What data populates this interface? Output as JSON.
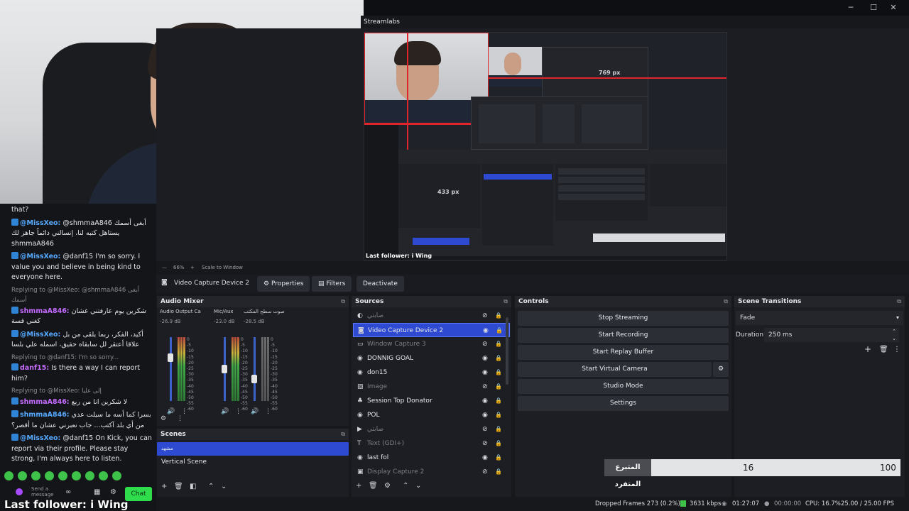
{
  "window": {
    "app_label": "Streamlabs",
    "min_icon": "minimize-icon",
    "max_icon": "maximize-icon",
    "close_icon": "close-icon"
  },
  "chat": {
    "top_text": "that?",
    "messages": [
      {
        "user": "@MissXeo:",
        "text": "@shmmaA846 أبغى أسمك يستاهل كتبه لنا، إنسالني دائماً جاهز لك shmmaA846",
        "kind": "main"
      },
      {
        "user": "@MissXeo:",
        "text": "@danf15 I'm so sorry. I value you and believe in being kind to everyone here.",
        "kind": "main"
      },
      {
        "reply": "Replying to @MissXeo: @shmmaA846 أبغى أسمك",
        "user": "shmmaA846:",
        "text": "شكرين يوم عارفتني غشان كغني قسة",
        "kind": "pink"
      },
      {
        "user": "@MissXeo:",
        "text": "أكيد، الفكر، ربما يلقى من بل علاقا أعتقر لل سابقاه حقيق، اسمله علي بلسا",
        "kind": "main"
      },
      {
        "reply": "Replying to @danf15: I'm so sorry...",
        "user": "danf15:",
        "text": "Is there a way I can report him?",
        "kind": "pink"
      },
      {
        "reply": "Replying to @MissXeo: إلى عليا",
        "user": "shmmaA846:",
        "text": "لا شكرين انا من ربع",
        "kind": "pink"
      },
      {
        "user": "shmmaA846:",
        "text": "بسرا كما أسه ما سيلت عدي من أي بلد آكتب... جاب نعبرني عشان ما أقصر؟",
        "kind": "main"
      },
      {
        "user": "@MissXeo:",
        "text": "@danf15 On Kick, you can report via their profile. Please stay strong, I'm always here to listen.",
        "kind": "main"
      }
    ],
    "send_label": "Send a message",
    "chat_button": "Chat",
    "last_follower": "Last follower: i Wing"
  },
  "preview": {
    "nested_label_px": "769 px",
    "nested_label_small": "433 px",
    "nested_follower": "Last follower: i Wing",
    "zoom": "66%",
    "scale_mode": "Scale to Window"
  },
  "source_toolbar": {
    "source_name": "Video Capture Device 2",
    "properties": "Properties",
    "filters": "Filters",
    "deactivate": "Deactivate"
  },
  "audio_mixer": {
    "title": "Audio Mixer",
    "channels": [
      {
        "name": "Audio Output Capt",
        "db": "-26.9 dB",
        "level": 0.68
      },
      {
        "name": "Mic/Aux",
        "db": "-23.0 dB",
        "level": 0.5
      },
      {
        "name": "صوت سطح المكتب",
        "db": "-28.5 dB",
        "level": 0.35
      }
    ],
    "ticks": [
      "0",
      "-5",
      "-10",
      "-15",
      "-20",
      "-25",
      "-30",
      "-35",
      "-40",
      "-45",
      "-50",
      "-55",
      "-60"
    ]
  },
  "sources": {
    "title": "Sources",
    "items": [
      {
        "name": "صابتي",
        "icon": "audio-icon",
        "dim": true,
        "selected": false
      },
      {
        "name": "Video Capture Device 2",
        "icon": "camera-icon",
        "dim": false,
        "selected": true
      },
      {
        "name": "Window Capture 3",
        "icon": "window-icon",
        "dim": true,
        "selected": false
      },
      {
        "name": "DONNIG GOAL",
        "icon": "globe-icon",
        "dim": false,
        "selected": false
      },
      {
        "name": "don15",
        "icon": "globe-icon",
        "dim": false,
        "selected": false
      },
      {
        "name": "Image",
        "icon": "image-icon",
        "dim": true,
        "selected": false
      },
      {
        "name": "Session Top Donator",
        "icon": "widget-icon",
        "dim": false,
        "selected": false
      },
      {
        "name": "POL",
        "icon": "globe-icon",
        "dim": false,
        "selected": false
      },
      {
        "name": "صابتي",
        "icon": "media-icon",
        "dim": true,
        "selected": false
      },
      {
        "name": "Text (GDI+)",
        "icon": "text-icon",
        "dim": true,
        "selected": false
      },
      {
        "name": "last fol",
        "icon": "globe-icon",
        "dim": false,
        "selected": false
      },
      {
        "name": "Display Capture 2",
        "icon": "monitor-icon",
        "dim": true,
        "selected": false
      }
    ]
  },
  "scenes": {
    "title": "Scenes",
    "items": [
      {
        "name": "مشهد",
        "selected": true
      },
      {
        "name": "Vertical Scene",
        "selected": false
      }
    ]
  },
  "controls": {
    "title": "Controls",
    "stop_streaming": "Stop Streaming",
    "start_recording": "Start Recording",
    "start_replay": "Start Replay Buffer",
    "start_virtual_camera": "Start Virtual Camera",
    "studio_mode": "Studio Mode",
    "settings": "Settings"
  },
  "transitions": {
    "title": "Scene Transitions",
    "selected": "Fade",
    "duration_label": "Duration",
    "duration_value": "250 ms"
  },
  "overlay_bar": {
    "label": "المتبرع المتفرد",
    "left_value": "16",
    "right_value": "100",
    "fill": 1.0
  },
  "status": {
    "dropped_frames": "Dropped Frames 273 (0.2%)",
    "kbps": "3631 kbps",
    "stream_time": "01:27:07",
    "rec_time": "00:00:00",
    "cpu": "CPU: 16.7%",
    "fps": "25.00 / 25.00 FPS"
  }
}
